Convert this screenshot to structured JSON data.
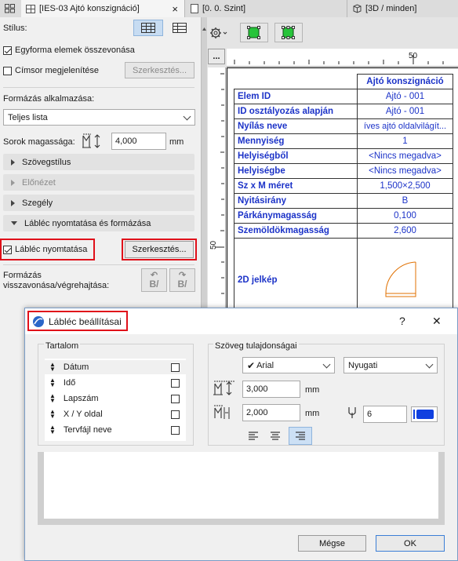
{
  "tabs": [
    {
      "label": "[IES-03 Ajtó konszignáció]",
      "close": "×"
    },
    {
      "label": "[0. 0. Szint]"
    },
    {
      "label": "[3D / minden]"
    }
  ],
  "left_panel": {
    "stilus_label": "Stílus:",
    "egyforma_label": "Egyforma elemek összevonása",
    "egyforma_checked": true,
    "cimsor_label": "Címsor megjelenítése",
    "cimsor_checked": false,
    "cimsor_edit": "Szerkesztés...",
    "formazas_label": "Formázás alkalmazása:",
    "formazas_value": "Teljes lista",
    "sorok_label": "Sorok magassága:",
    "sorok_value": "4,000",
    "sorok_unit": "mm",
    "sections": [
      "Szövegstílus",
      "Előnézet",
      "Szegély",
      "Lábléc nyomtatása és formázása"
    ],
    "lablec_label": "Lábléc nyomtatása",
    "lablec_checked": true,
    "lablec_edit": "Szerkesztés...",
    "undo_label_1": "Formázás",
    "undo_label_2": "visszavonása/végrehajtása:",
    "undo_glyph": "B/",
    "undo_glyph2": "B/"
  },
  "ruler": {
    "tick_50_top": "50",
    "tick_50_left": "50",
    "more_btn": "..."
  },
  "schedule": {
    "title": "Ajtó konszignáció",
    "rows": [
      {
        "k": "Elem ID",
        "v": "Ajtó - 001"
      },
      {
        "k": "ID osztályozás alapján",
        "v": "Ajtó - 001"
      },
      {
        "k": "Nyílás neve",
        "v": "íves ajtó oldalvilágít..."
      },
      {
        "k": "Mennyiség",
        "v": "1"
      },
      {
        "k": "Helyiségből",
        "v": "<Nincs megadva>"
      },
      {
        "k": "Helyiségbe",
        "v": "<Nincs megadva>"
      },
      {
        "k": "Sz x M méret",
        "v": "1,500×2,500"
      },
      {
        "k": "Nyitásirány",
        "v": "B"
      },
      {
        "k": "Párkánymagasság",
        "v": "0,100"
      },
      {
        "k": "Szemöldökmagasság",
        "v": "2,600"
      }
    ],
    "symbol_label": "2D jelkép"
  },
  "dialog": {
    "title": "Lábléc beállításai",
    "help": "?",
    "close": "✕",
    "tartalom_label": "Tartalom",
    "items": [
      {
        "label": "Dátum",
        "checked": false
      },
      {
        "label": "Idő",
        "checked": false
      },
      {
        "label": "Lapszám",
        "checked": false
      },
      {
        "label": "X / Y oldal",
        "checked": false
      },
      {
        "label": "Tervfájl neve",
        "checked": false
      }
    ],
    "szoveg_label": "Szöveg tulajdonságai",
    "font_value": "Arial",
    "script_value": "Nyugati",
    "size1_value": "3,000",
    "size1_unit": "mm",
    "size2_value": "2,000",
    "size2_unit": "mm",
    "pen_value": "6",
    "cancel": "Mégse",
    "ok": "OK"
  },
  "colors": {
    "schedule_text": "#1c33c8",
    "highlight_red": "#e0101a",
    "pen_blue": "#1040e0"
  }
}
